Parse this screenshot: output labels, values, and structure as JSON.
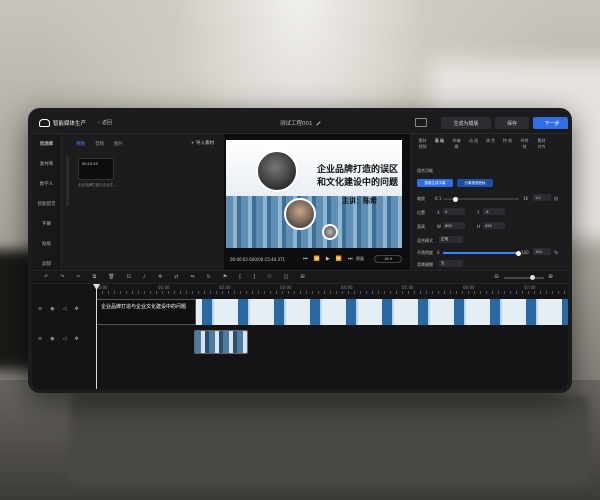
{
  "app": {
    "name": "智能媒体生产",
    "back_label": "返回",
    "project_title": "测试工程001",
    "generate_template_label": "生成为模版",
    "save_label": "保存",
    "next_label": "下一步"
  },
  "rail": [
    "资源库",
    "素材库",
    "数字人",
    "智能配音",
    "字幕",
    "贴纸",
    "滤镜"
  ],
  "assets": {
    "tabs": [
      "视频",
      "音频",
      "图片"
    ],
    "import_label": "+ 导入素材",
    "item_time": "00:15:19",
    "item_caption": "企业品牌打造与企业文..."
  },
  "preview": {
    "slide_title_line1": "企业品牌打造的误区",
    "slide_title_line2": "和文化建设中的问题",
    "speaker": "主讲：陈希",
    "current_time": "00:00:02.600",
    "total_time": "00:15:44.371",
    "resolution_label": "原画",
    "ratio_label": "16:9"
  },
  "props": {
    "tabs": [
      "素材 视频",
      "基 础",
      "AI编 辑",
      "动 画",
      "调 色",
      "特 效",
      "AI特 效",
      "素材 对齐"
    ],
    "section": "组合功能",
    "btn_smart_caption": "智能生成字幕",
    "btn_split_audio": "分离视频音轨",
    "scale_label": "缩放",
    "scale_min": "0.1",
    "scale_max": "16",
    "scale_value": "1.0",
    "scale_unit": "倍",
    "position_label": "位置",
    "pos_x_label": "X",
    "pos_x": "0",
    "pos_y_label": "Y",
    "pos_y": "-6",
    "size_label": "宽高",
    "size_w_label": "W",
    "size_w": "800",
    "size_h_label": "H",
    "size_h": "450",
    "blend_label": "混合模式",
    "blend_value": "正常",
    "opacity_label": "不透明度",
    "opacity_min": "0",
    "opacity_max": "100",
    "opacity_value": "100",
    "opacity_unit": "%",
    "bg_label": "背景模糊",
    "bg_value": "无"
  },
  "timeline": {
    "ruler_marks": [
      "00:00",
      "01:00",
      "02:00",
      "03:00",
      "04:00",
      "05:00",
      "06:00",
      "07:00"
    ],
    "clip1_text": "企业品牌打造与企业文化建设中的问题"
  }
}
